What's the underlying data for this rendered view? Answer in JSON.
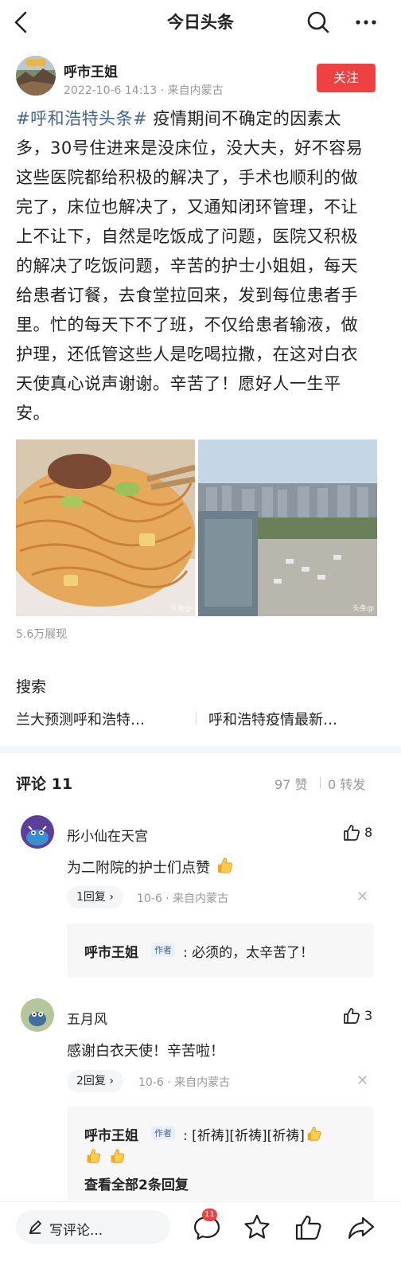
{
  "header": {
    "title": "今日头条"
  },
  "author": {
    "name": "呼市王姐",
    "meta": "2022-10-6 14:13 · 来自内蒙古",
    "follow_label": "关注"
  },
  "post": {
    "hashtag": "#呼和浩特头条#",
    "text": " 疫情期间不确定的因素太多，30号住进来是没床位，没大夫，好不容易这些医院都给积极的解决了，手术也顺利的做完了，床位也解决了，又通知闭环管理，不让上不让下，自然是吃饭成了问题，医院又积极的解决了吃饭问题，辛苦的护士小姐姐，每天给患者订餐，去食堂拉回来，发到每位患者手里。忙的每天下不了班，不仅给患者输液，做护理，还低管这些人是吃喝拉撒，在这对白衣天使真心说声谢谢。辛苦了！愿好人一生平安。",
    "image_watermark": "头条@",
    "views": "5.6万展现"
  },
  "search": {
    "title": "搜索",
    "suggestions": [
      "兰大预测呼和浩特…",
      "呼和浩特疫情最新…"
    ]
  },
  "comments_header": {
    "title": "评论 11",
    "likes": "97 赞",
    "forwards": "0 转发"
  },
  "comments": [
    {
      "name": "彤小仙在天宫",
      "likes": "8",
      "text": "为二附院的护士们点赞",
      "reply_label": "1回复",
      "meta": "10-6 · 来自内蒙古",
      "reply": {
        "name": "呼市王姐",
        "tag": "作者",
        "text": ": 必须的，太辛苦了！"
      }
    },
    {
      "name": "五月风",
      "likes": "3",
      "text": "感谢白衣天使！辛苦啦！",
      "reply_label": "2回复",
      "meta": "10-6 · 来自内蒙古",
      "reply": {
        "name": "呼市王姐",
        "tag": "作者",
        "text": ": [祈祷][祈祷][祈祷]",
        "more": "查看全部2条回复"
      }
    }
  ],
  "bottom_bar": {
    "write_placeholder": "写评论...",
    "comment_badge": "11"
  },
  "icons": [
    "back-icon",
    "search-icon",
    "more-icon",
    "thumbs-up-icon",
    "close-icon",
    "pen-icon",
    "comment-icon",
    "star-icon",
    "share-icon",
    "thumbs-up-emoji-icon"
  ],
  "colors": {
    "accent_red": "#f04142",
    "link_blue": "#406599",
    "muted_gray": "#999999"
  }
}
